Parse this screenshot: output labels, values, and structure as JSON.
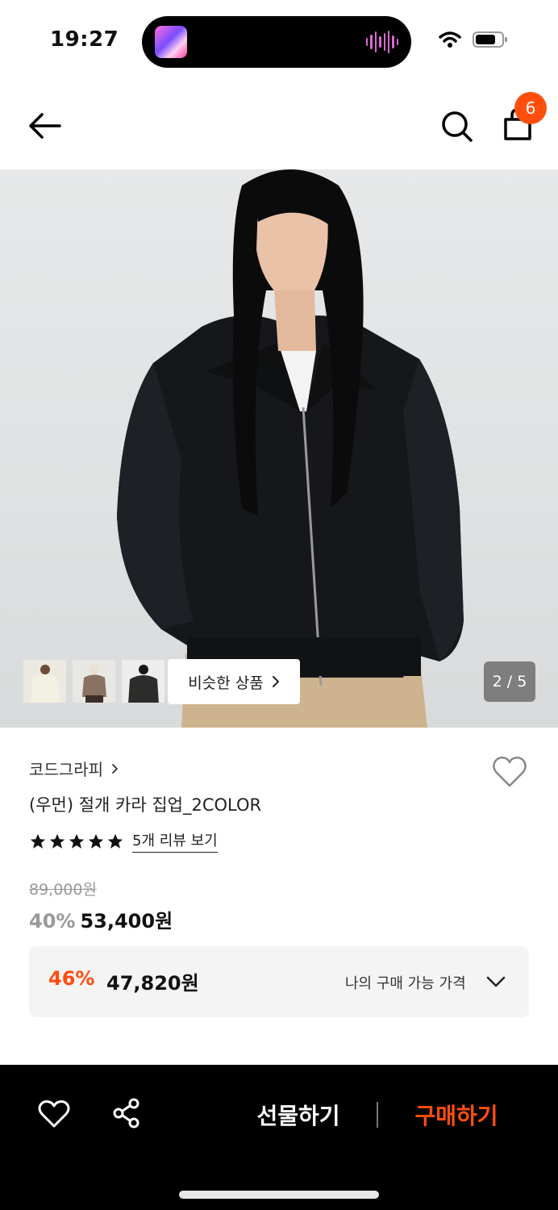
{
  "status_bar": {
    "time": "19:27"
  },
  "nav": {
    "cart_count": "6"
  },
  "gallery": {
    "similar_label": "비슷한 상품",
    "page_indicator": "2 / 5"
  },
  "product": {
    "brand": "코드그라피",
    "name": "(우먼) 절개 카라 집업_2COLOR",
    "rating_stars": 5,
    "review_link": "5개 리뷰 보기",
    "original_price": "89,000원",
    "discount": "40%",
    "price": "53,400원"
  },
  "my_price": {
    "discount": "46%",
    "price": "47,820원",
    "label": "나의 구매 가능 가격"
  },
  "bottom_bar": {
    "gift_label": "선물하기",
    "buy_label": "구매하기"
  },
  "colors": {
    "accent": "#ff4e0e",
    "bottom_bar_bg": "#000000"
  }
}
